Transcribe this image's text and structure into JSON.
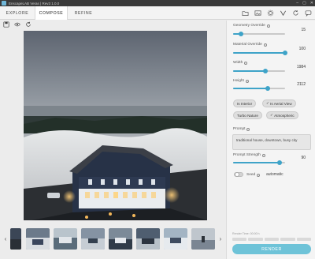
{
  "window": {
    "title": "EnscapeLAB Veras | Rev3 1.0.0",
    "minimize_icon": "minimize-icon",
    "maximize_icon": "maximize-icon",
    "close_icon": "close-icon"
  },
  "nav": {
    "tabs": [
      {
        "label": "EXPLORE",
        "active": false
      },
      {
        "label": "COMPOSE",
        "active": true
      },
      {
        "label": "REFINE",
        "active": false
      }
    ],
    "icons": [
      "folder-icon",
      "gallery-icon",
      "settings-icon",
      "brand-icon",
      "refresh-icon",
      "chat-icon"
    ]
  },
  "toolbar": {
    "icons": [
      "save-icon",
      "eye-icon",
      "rotate-icon"
    ]
  },
  "panel": {
    "geometry": {
      "label": "Geometry Override",
      "value": "15",
      "fraction": 0.15
    },
    "material": {
      "label": "Material Override",
      "value": "100",
      "fraction": 1.0
    },
    "width": {
      "label": "Width",
      "value": "1984",
      "fraction": 0.62
    },
    "height": {
      "label": "Height",
      "value": "2112",
      "fraction": 0.66
    },
    "chips": [
      {
        "label": "Is Interior",
        "checked": false
      },
      {
        "label": "Is Aerial View",
        "checked": true
      },
      {
        "label": "Turbo Nature",
        "checked": false
      },
      {
        "label": "Atmospheric",
        "checked": true
      }
    ],
    "prompt": {
      "label": "Prompt",
      "value": "traditional house, downtown, busy city"
    },
    "prompt_strength": {
      "label": "Prompt Strength",
      "value": "90",
      "fraction": 0.9
    },
    "seed": {
      "label": "Seed",
      "value": "automatic"
    },
    "credits": "Render Time: 00:00 h",
    "render_label": "RENDER"
  },
  "colors": {
    "accent": "#3ea3c8",
    "render_button": "#6ec3d8"
  }
}
